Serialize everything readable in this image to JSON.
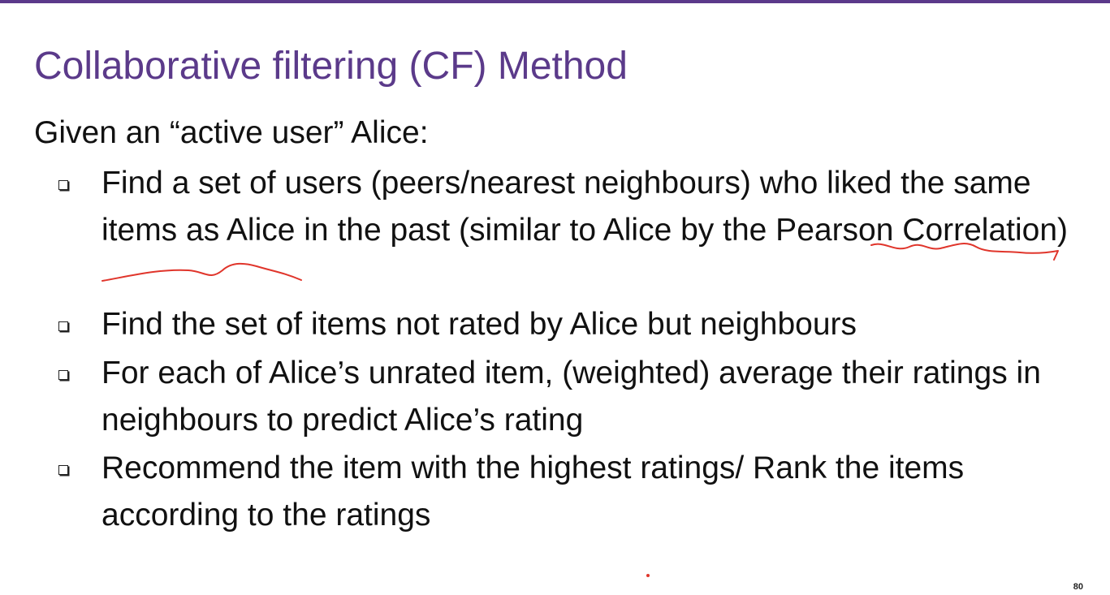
{
  "slide": {
    "title": "Collaborative filtering (CF) Method",
    "intro": "Given an “active user” Alice:",
    "bullets": [
      "Find a set of users (peers/nearest neighbours) who liked the same items as Alice in the past (similar to Alice by the Pearson Correlation)",
      "Find the set of items not rated by Alice but neighbours",
      "For each of Alice’s unrated item, (weighted) average their ratings in neighbours to predict Alice’s rating",
      "Recommend the item with the highest ratings/ Rank the items according to the ratings"
    ],
    "page_number": "80"
  },
  "colors": {
    "title": "#5b3a8a",
    "accent_bar": "#5b3a8a",
    "body_text": "#111111",
    "annotation_ink": "#e0352b"
  }
}
